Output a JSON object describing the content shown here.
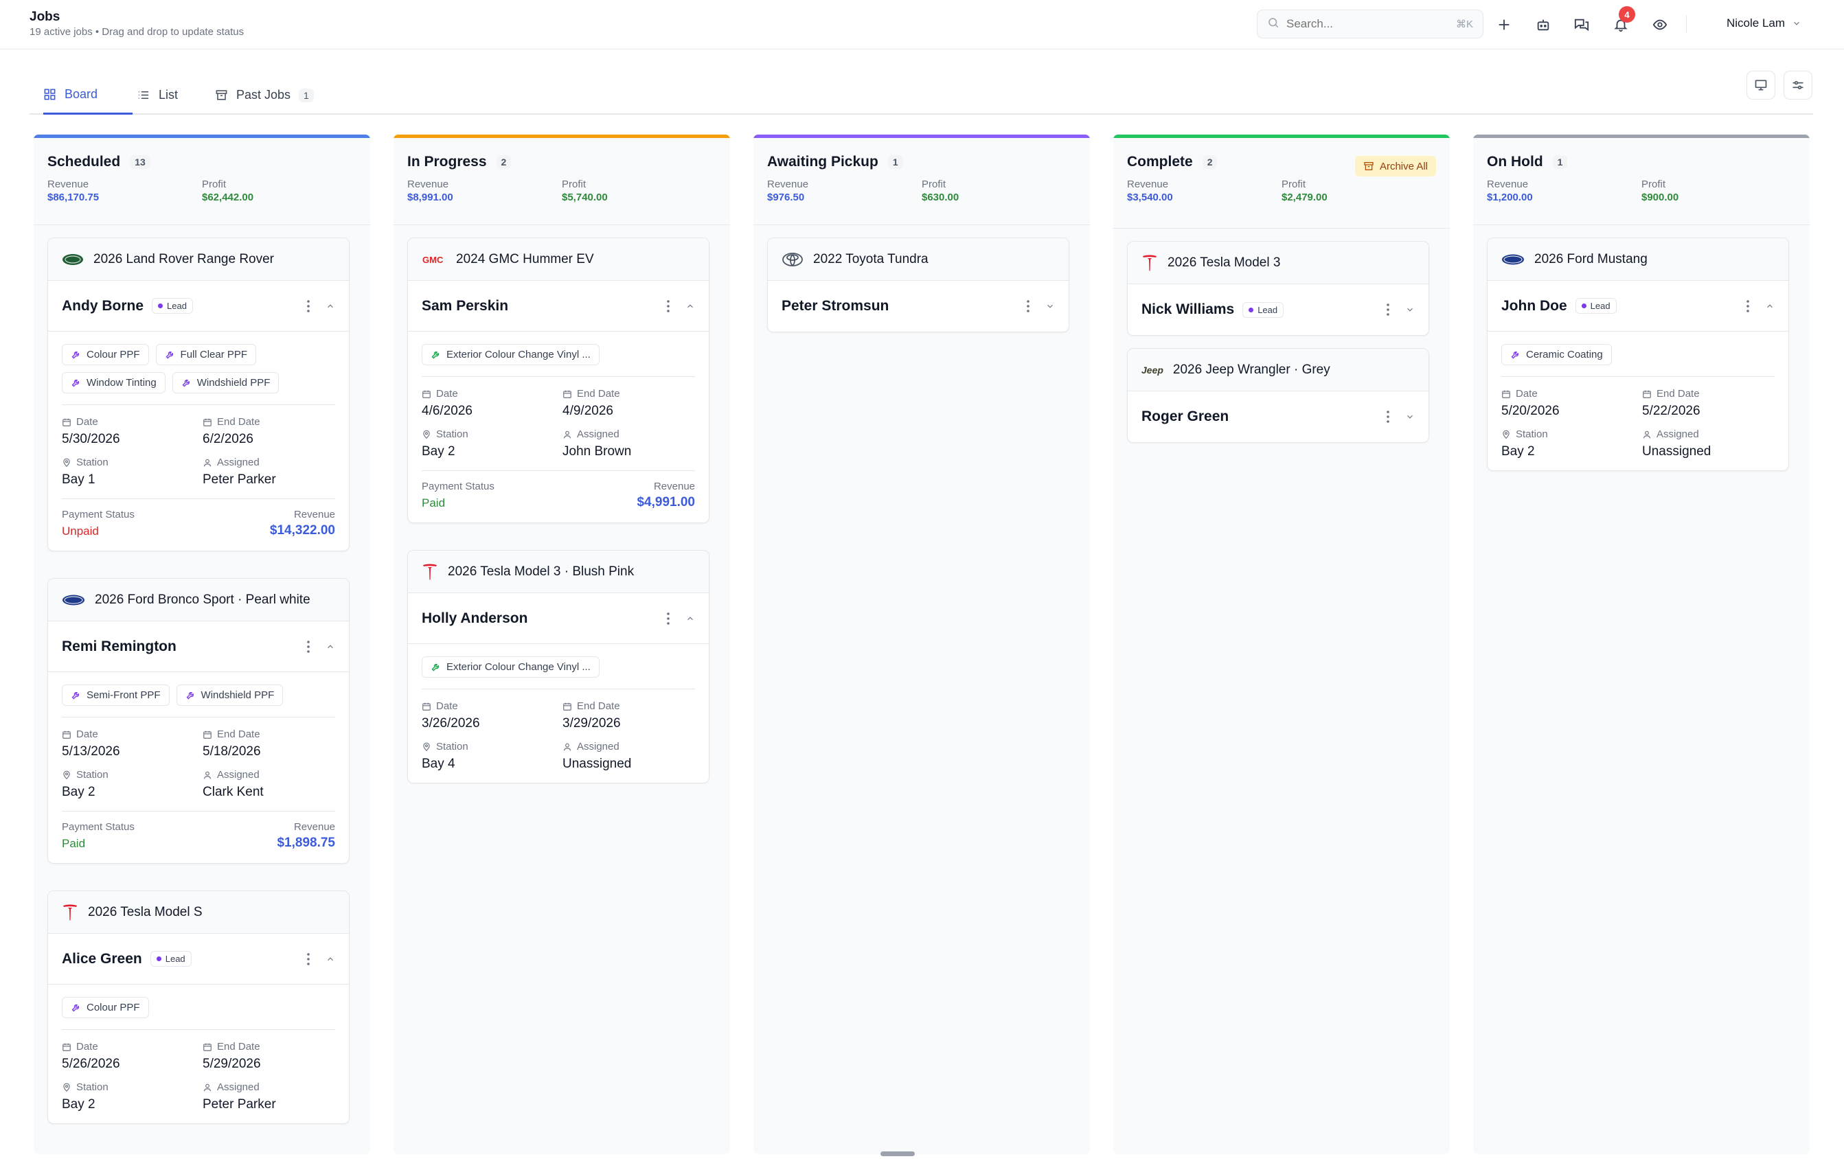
{
  "header": {
    "title": "Jobs",
    "subtitle": "19 active jobs • Drag and drop to update status",
    "search_placeholder": "Search...",
    "search_shortcut": "⌘K",
    "notification_count": "4",
    "user_name": "Nicole Lam"
  },
  "tabs": [
    {
      "label": "Board",
      "icon": "grid-icon",
      "active": true
    },
    {
      "label": "List",
      "icon": "list-icon",
      "active": false
    },
    {
      "label": "Past Jobs",
      "icon": "archive-icon",
      "count": "1",
      "active": false
    }
  ],
  "columns": [
    {
      "title": "Scheduled",
      "count": "13",
      "color": "#4f7fe6",
      "revenue_label": "Revenue",
      "revenue": "$86,170.75",
      "profit_label": "Profit",
      "profit": "$62,442.00",
      "cards": [
        {
          "vehicle": "2026 Land Rover Range Rover",
          "brand": "land-rover-logo-icon",
          "customer": "Andy Borne",
          "lead": "Lead",
          "services": [
            "Colour PPF",
            "Full Clear PPF",
            "Window Tinting",
            "Windshield PPF"
          ],
          "date_label": "Date",
          "date": "5/30/2026",
          "end_label": "End Date",
          "end": "6/2/2026",
          "station_label": "Station",
          "station": "Bay 1",
          "assigned_label": "Assigned",
          "assigned": "Peter Parker",
          "pay_label": "Payment Status",
          "pay": "Unpaid",
          "rev_label": "Revenue",
          "rev": "$14,322.00"
        },
        {
          "vehicle": "2026 Ford Bronco Sport · Pearl white",
          "brand": "ford-logo-icon",
          "customer": "Remi Remington",
          "services": [
            "Semi-Front PPF",
            "Windshield PPF"
          ],
          "date_label": "Date",
          "date": "5/13/2026",
          "end_label": "End Date",
          "end": "5/18/2026",
          "station_label": "Station",
          "station": "Bay 2",
          "assigned_label": "Assigned",
          "assigned": "Clark Kent",
          "pay_label": "Payment Status",
          "pay": "Paid",
          "rev_label": "Revenue",
          "rev": "$1,898.75"
        },
        {
          "vehicle": "2026 Tesla Model S",
          "brand": "tesla-logo-icon",
          "customer": "Alice Green",
          "lead": "Lead",
          "services": [
            "Colour PPF"
          ],
          "date_label": "Date",
          "date": "5/26/2026",
          "end_label": "End Date",
          "end": "5/29/2026",
          "station_label": "Station",
          "station": "Bay 2",
          "assigned_label": "Assigned",
          "assigned": "Peter Parker"
        }
      ]
    },
    {
      "title": "In Progress",
      "count": "2",
      "color": "#f59e0b",
      "revenue_label": "Revenue",
      "revenue": "$8,991.00",
      "profit_label": "Profit",
      "profit": "$5,740.00",
      "cards": [
        {
          "vehicle": "2024 GMC Hummer EV",
          "brand": "gmc-logo-icon",
          "customer": "Sam Perskin",
          "services": [
            "Exterior Colour Change Vinyl ..."
          ],
          "date_label": "Date",
          "date": "4/6/2026",
          "end_label": "End Date",
          "end": "4/9/2026",
          "station_label": "Station",
          "station": "Bay 2",
          "assigned_label": "Assigned",
          "assigned": "John Brown",
          "pay_label": "Payment Status",
          "pay": "Paid",
          "rev_label": "Revenue",
          "rev": "$4,991.00"
        },
        {
          "vehicle": "2026 Tesla Model 3 · Blush Pink",
          "brand": "tesla-logo-icon",
          "customer": "Holly Anderson",
          "services": [
            "Exterior Colour Change Vinyl ..."
          ],
          "date_label": "Date",
          "date": "3/26/2026",
          "end_label": "End Date",
          "end": "3/29/2026",
          "station_label": "Station",
          "station": "Bay 4",
          "assigned_label": "Assigned",
          "assigned": "Unassigned"
        }
      ]
    },
    {
      "title": "Awaiting Pickup",
      "count": "1",
      "color": "#8b5cf6",
      "revenue_label": "Revenue",
      "revenue": "$976.50",
      "profit_label": "Profit",
      "profit": "$630.00",
      "cards": [
        {
          "vehicle": "2022 Toyota Tundra",
          "brand": "toyota-logo-icon",
          "customer": "Peter Stromsun"
        }
      ]
    },
    {
      "title": "Complete",
      "count": "2",
      "color": "#22c55e",
      "archive_label": "Archive All",
      "revenue_label": "Revenue",
      "revenue": "$3,540.00",
      "profit_label": "Profit",
      "profit": "$2,479.00",
      "cards": [
        {
          "vehicle": "2026 Tesla Model 3",
          "brand": "tesla-logo-icon",
          "customer": "Nick Williams",
          "lead": "Lead"
        },
        {
          "vehicle": "2026 Jeep Wrangler · Grey",
          "brand": "jeep-logo-icon",
          "brand_text": "Jeep",
          "customer": "Roger Green"
        }
      ]
    },
    {
      "title": "On Hold",
      "count": "1",
      "color": "#9ca3af",
      "revenue_label": "Revenue",
      "revenue": "$1,200.00",
      "profit_label": "Profit",
      "profit": "$900.00",
      "cards": [
        {
          "vehicle": "2026 Ford Mustang",
          "brand": "ford-logo-icon",
          "customer": "John Doe",
          "lead": "Lead",
          "services": [
            "Ceramic Coating"
          ],
          "date_label": "Date",
          "date": "5/20/2026",
          "end_label": "End Date",
          "end": "5/22/2026",
          "station_label": "Station",
          "station": "Bay 2",
          "assigned_label": "Assigned",
          "assigned": "Unassigned"
        }
      ]
    }
  ]
}
